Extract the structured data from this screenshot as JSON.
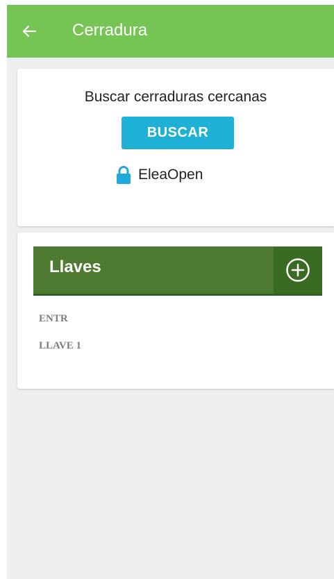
{
  "appbar": {
    "title": "Cerradura",
    "back_icon": "arrow-left-icon",
    "color": "#76c453"
  },
  "search_card": {
    "label": "Buscar cerraduras cercanas",
    "button_label": "BUSCAR",
    "button_color": "#1fb0d6",
    "lock_icon": "lock-icon",
    "lock_name": "EleaOpen"
  },
  "keys_card": {
    "title": "Llaves",
    "add_icon": "add-circle-icon",
    "header_color": "#4e7a32",
    "items": [
      {
        "label": "ENTR"
      },
      {
        "label": "LLAVE 1"
      }
    ]
  }
}
